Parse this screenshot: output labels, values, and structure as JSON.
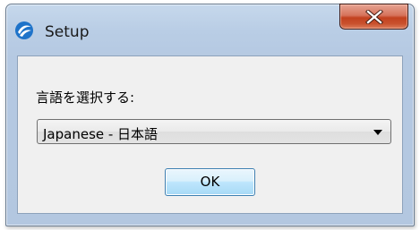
{
  "window": {
    "title": "Setup",
    "icon": "setup-app-icon",
    "close_icon": "close-icon"
  },
  "dialog": {
    "prompt": "言語を選択する:",
    "language_select": {
      "selected": "Japanese - 日本語",
      "arrow_icon": "chevron-down-icon"
    },
    "ok_label": "OK"
  },
  "colors": {
    "frame": "#b9cde5",
    "close_button": "#c9522e",
    "ok_button": "#bee6fd",
    "client": "#f0f0f0"
  }
}
